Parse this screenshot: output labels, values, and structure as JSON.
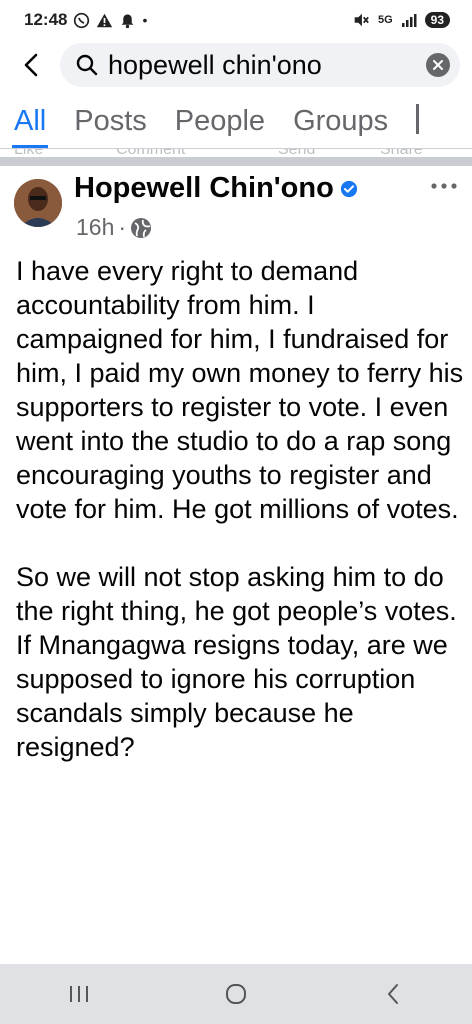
{
  "status_bar": {
    "time": "12:48",
    "network": "5G",
    "battery": "93",
    "left_icons": [
      "whatsapp-icon",
      "warning-icon",
      "notification-icon"
    ],
    "right_icons": [
      "mute-icon",
      "signal-icon",
      "battery-icon"
    ]
  },
  "search": {
    "query": "hopewell chin'ono"
  },
  "tabs": [
    {
      "label": "All",
      "active": true
    },
    {
      "label": "Posts",
      "active": false
    },
    {
      "label": "People",
      "active": false
    },
    {
      "label": "Groups",
      "active": false
    }
  ],
  "ghost_actions": [
    "Like",
    "Comment",
    "Send",
    "Share"
  ],
  "post": {
    "author": "Hopewell Chin'ono",
    "verified": true,
    "time": "16h",
    "separator": "·",
    "audience_icon": "globe-icon",
    "paragraphs": [
      "I have every right to demand accountability from him. I campaigned for him, I fundraised for him, I paid my own money to ferry his supporters to register to vote. I even went into the studio to do a rap song encouraging youths to register and vote for him. He got millions of votes.",
      "So we will not stop asking him to do the right thing, he got people’s votes.",
      "If Mnangagwa resigns today, are we supposed to ignore his corruption scandals simply because he resigned?"
    ]
  },
  "colors": {
    "accent": "#1877f2",
    "secondary_text": "#65676b",
    "separator": "#c9ccd1",
    "nav_bar": "#dfe1e5"
  }
}
